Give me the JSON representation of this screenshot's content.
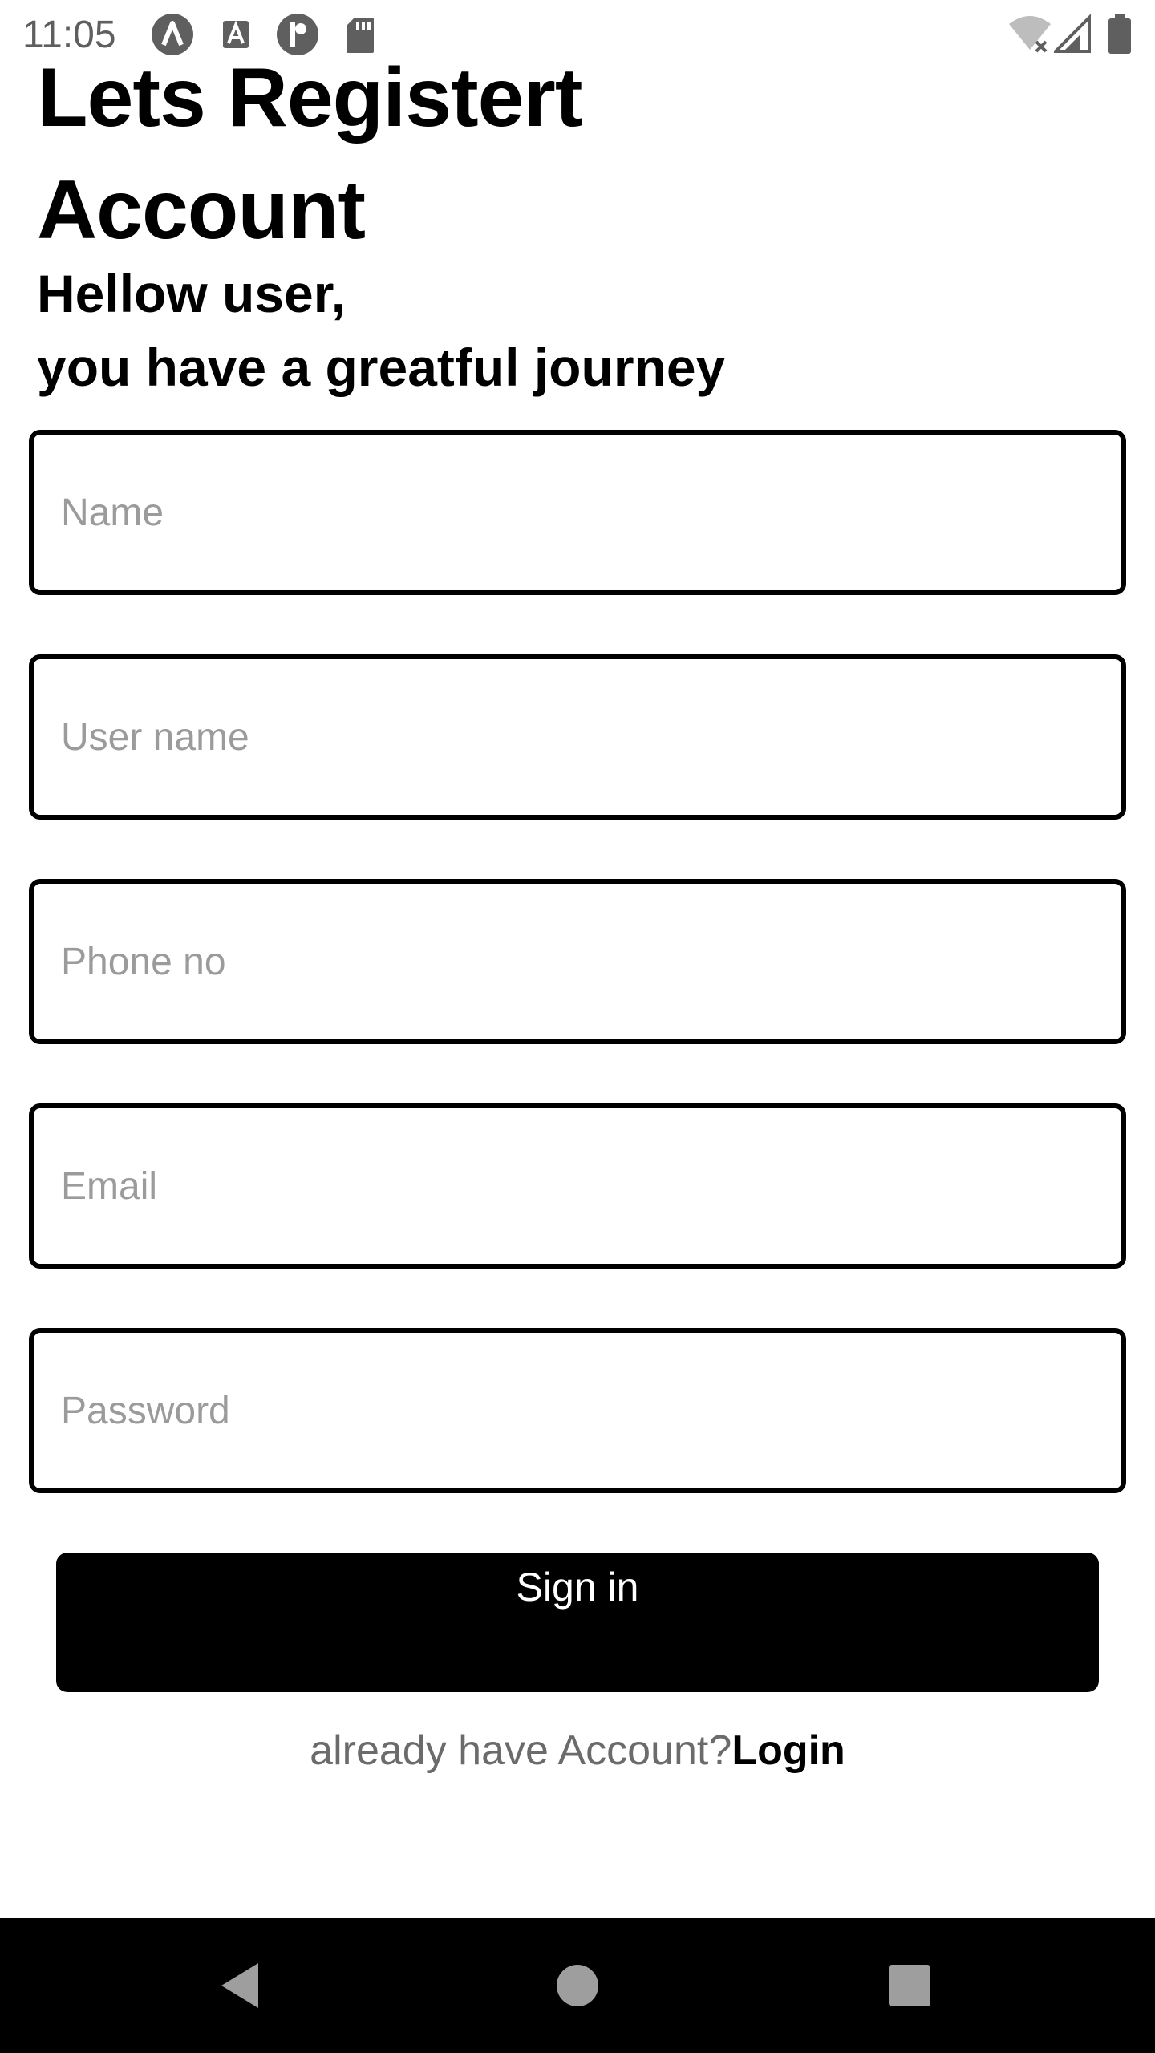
{
  "status_bar": {
    "time": "11:05",
    "icons": [
      "app-a-icon",
      "text-a-icon",
      "app-r-icon",
      "sd-card-icon",
      "wifi-off-icon",
      "cell-signal-icon",
      "battery-icon"
    ]
  },
  "header": {
    "title": "Lets Registert Account",
    "subtitle_line1": "Hellow user,",
    "subtitle_line2": "you have a greatful journey"
  },
  "form": {
    "name": {
      "value": "",
      "placeholder": "Name"
    },
    "username": {
      "value": "",
      "placeholder": "User name"
    },
    "phone": {
      "value": "",
      "placeholder": "Phone no"
    },
    "email": {
      "value": "",
      "placeholder": "Email"
    },
    "password": {
      "value": "",
      "placeholder": "Password"
    },
    "submit_label": "Sign in"
  },
  "footer": {
    "prompt": "already have Account?",
    "login_label": "Login"
  },
  "nav_bar": {
    "icons": [
      "back-icon",
      "home-icon",
      "recents-icon"
    ]
  },
  "colors": {
    "background": "#ffffff",
    "primary": "#000000",
    "placeholder": "#9b9b9b",
    "muted_text": "#6b6b6b",
    "status_text": "#5f5f5f"
  }
}
